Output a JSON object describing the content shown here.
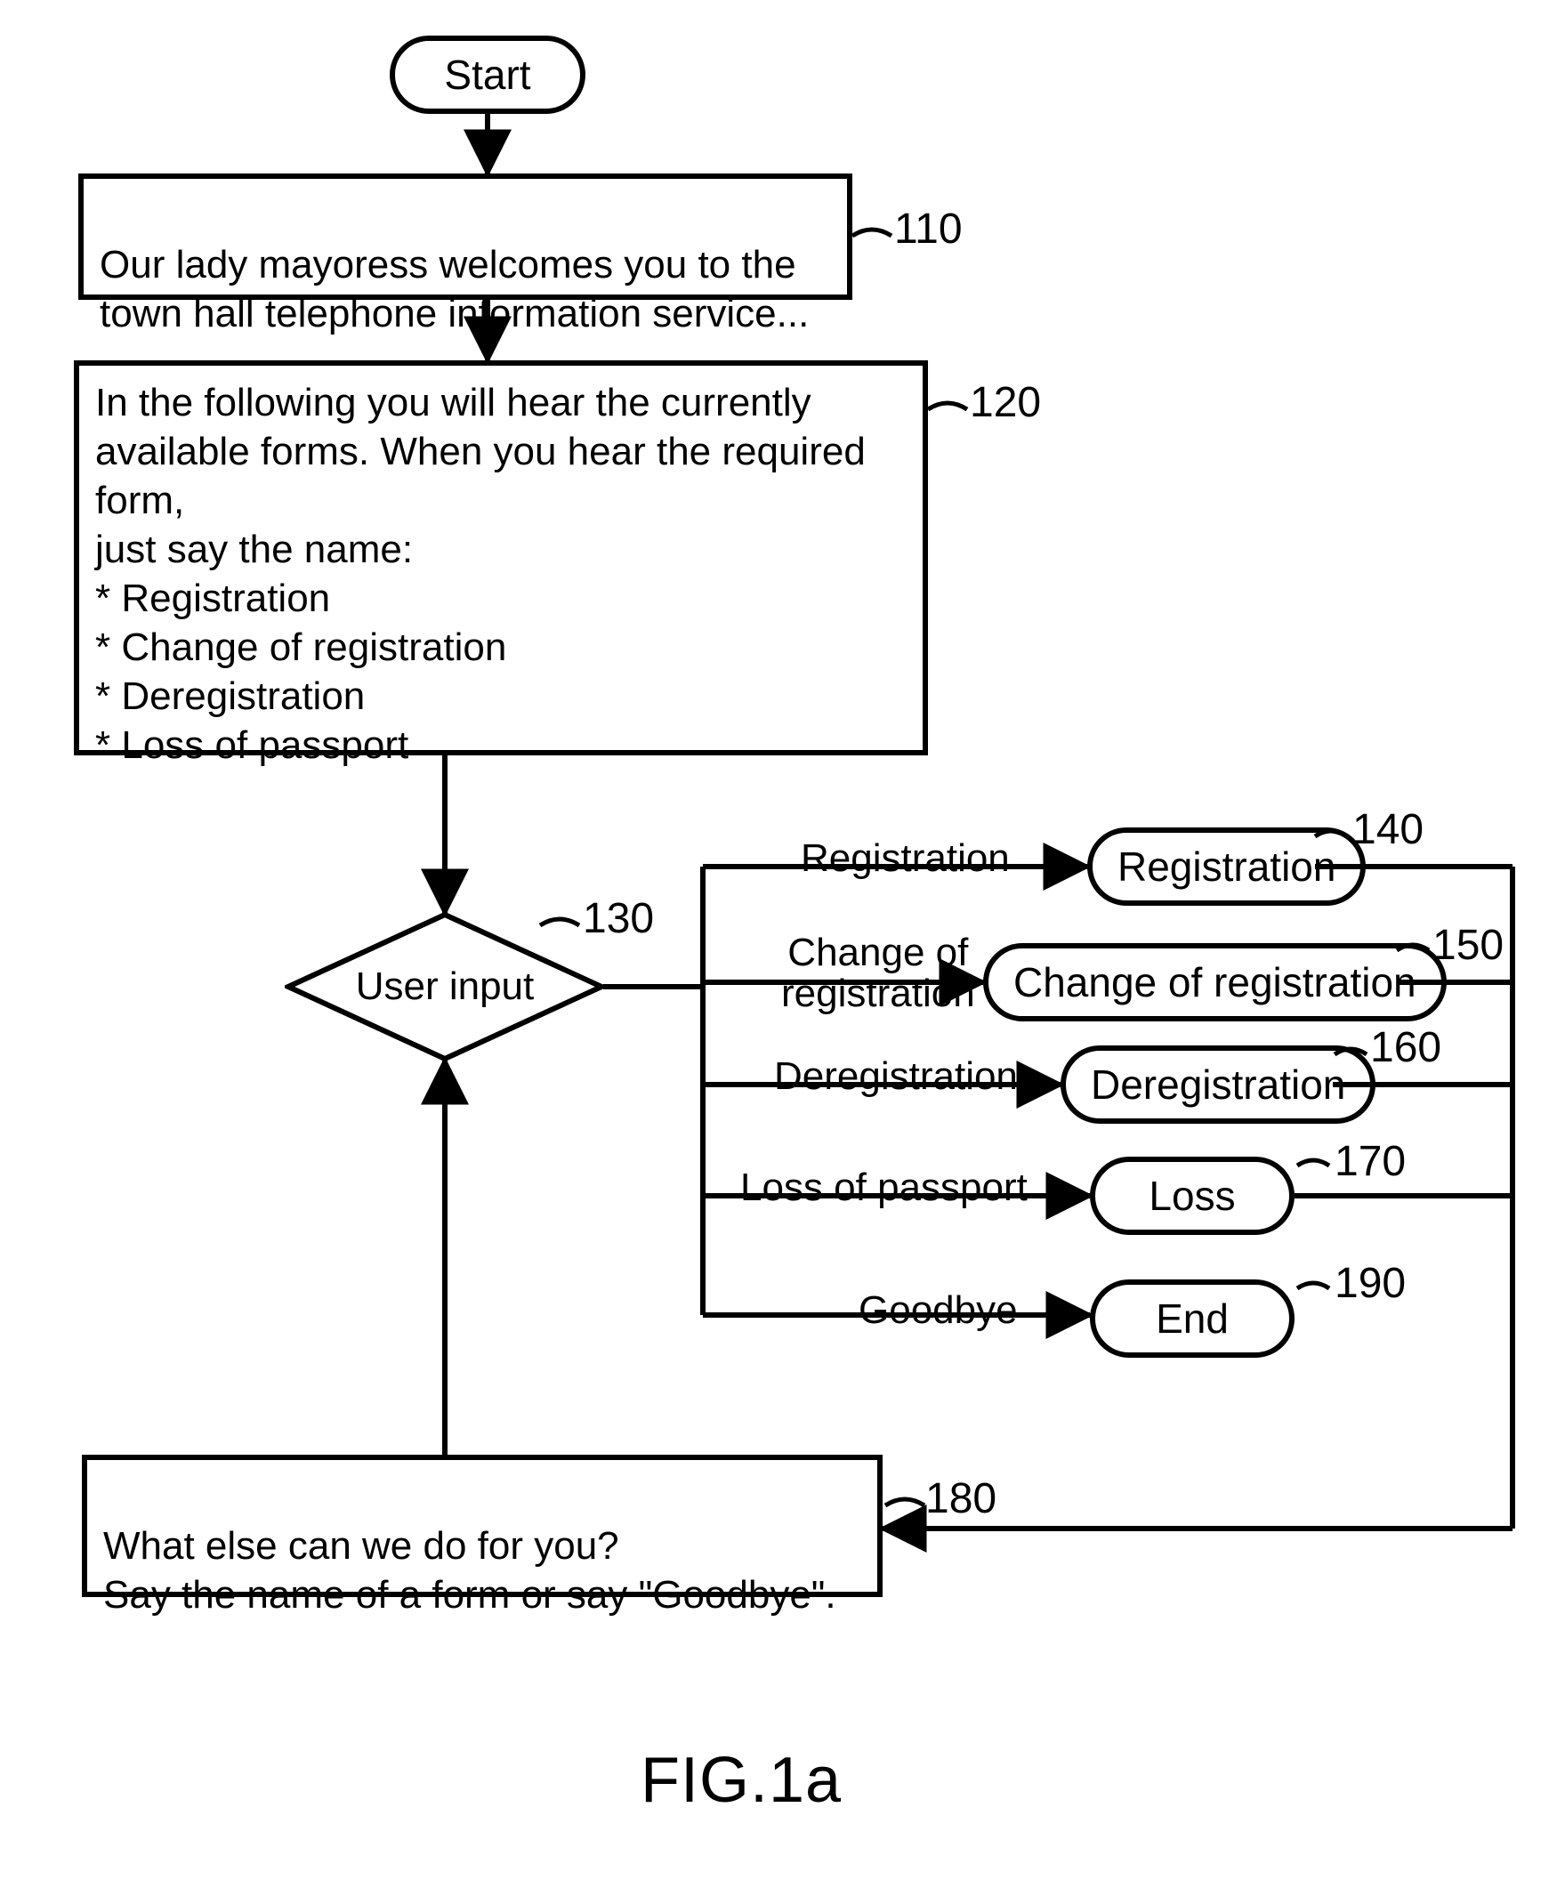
{
  "figure_label": "FIG.1a",
  "start_pill": "Start",
  "box110": {
    "text": "Our lady mayoress welcomes you to the\ntown hall telephone information service...",
    "ref": "110"
  },
  "box120": {
    "intro": "In the following you will hear the currently available forms. When you hear the required form,\njust say the name:",
    "items": [
      "Registration",
      "Change of registration",
      "Deregistration",
      "Loss of passport"
    ],
    "ref": "120"
  },
  "decision130": {
    "label": "User input",
    "ref": "130"
  },
  "branches": [
    {
      "edge_label": "Registration",
      "pill": "Registration",
      "ref": "140"
    },
    {
      "edge_label": "Change of\nregistration",
      "pill": "Change of registration",
      "ref": "150"
    },
    {
      "edge_label": "Deregistration",
      "pill": "Deregistration",
      "ref": "160"
    },
    {
      "edge_label": "Loss of passport",
      "pill": "Loss",
      "ref": "170"
    },
    {
      "edge_label": "Goodbye",
      "pill": "End",
      "ref": "190"
    }
  ],
  "box180": {
    "text": "What else can we do for you?\nSay the name of a form or say \"Goodbye\".",
    "ref": "180"
  }
}
